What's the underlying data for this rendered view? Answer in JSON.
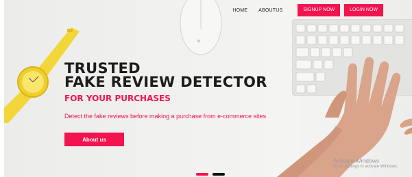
{
  "nav": {
    "home": "HOME",
    "about": "ABOUTUS",
    "signup": "SIGNUP NOW",
    "login": "LOGIN NOW"
  },
  "hero": {
    "title_line1": "TRUSTED",
    "title_line2": "FAKE REVIEW DETECTOR",
    "subtitle": "FOR YOUR PURCHASES",
    "description": "Detect the fake reviews before making a purchase from e-commerce sites",
    "button": "About us"
  },
  "carousel": {
    "slides": 2,
    "active": 1
  },
  "watermark": {
    "title": "Activate Windows",
    "subtitle": "Go to Settings to activate Windows."
  },
  "colors": {
    "accent": "#f2134f",
    "text": "#1c1c1c"
  }
}
